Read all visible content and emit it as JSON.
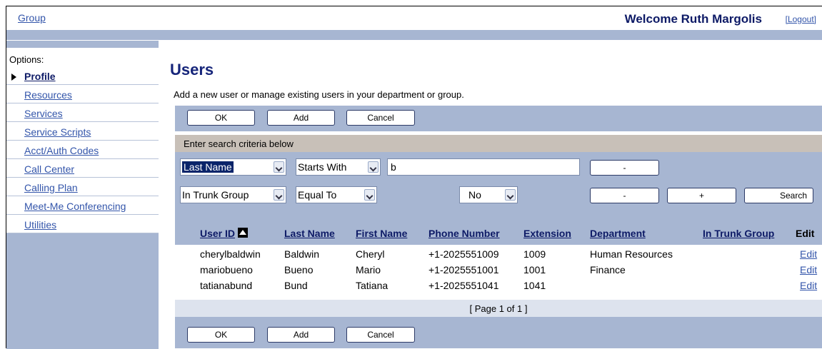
{
  "header": {
    "group_link": "Group",
    "welcome": "Welcome Ruth Margolis",
    "logout": "[Logout]"
  },
  "sidebar": {
    "title": "Options:",
    "items": [
      {
        "label": "Profile",
        "active": true
      },
      {
        "label": "Resources"
      },
      {
        "label": "Services"
      },
      {
        "label": "Service Scripts"
      },
      {
        "label": "Acct/Auth Codes"
      },
      {
        "label": "Call Center"
      },
      {
        "label": "Calling Plan"
      },
      {
        "label": "Meet-Me Conferencing"
      },
      {
        "label": "Utilities"
      }
    ]
  },
  "page": {
    "title": "Users",
    "description": "Add a new user or manage existing users in your department or group."
  },
  "buttons": {
    "ok": "OK",
    "add": "Add",
    "cancel": "Cancel"
  },
  "search": {
    "heading": "Enter search criteria below",
    "row1": {
      "field": "Last Name",
      "operator": "Starts With",
      "value": "b",
      "remove": "-"
    },
    "row2": {
      "field": "In Trunk Group",
      "operator": "Equal To",
      "value": "No",
      "remove": "-",
      "add": "+",
      "search": "Search"
    }
  },
  "table": {
    "headers": [
      "User ID",
      "Last Name",
      "First Name",
      "Phone Number",
      "Extension",
      "Department",
      "In Trunk Group",
      "Edit"
    ],
    "rows": [
      {
        "user_id": "cherylbaldwin",
        "last": "Baldwin",
        "first": "Cheryl",
        "phone": "+1-2025551009",
        "ext": "1009",
        "dept": "Human Resources",
        "trunk": "",
        "edit": "Edit"
      },
      {
        "user_id": "mariobueno",
        "last": "Bueno",
        "first": "Mario",
        "phone": "+1-2025551001",
        "ext": "1001",
        "dept": "Finance",
        "trunk": "",
        "edit": "Edit"
      },
      {
        "user_id": "tatianabund",
        "last": "Bund",
        "first": "Tatiana",
        "phone": "+1-2025551041",
        "ext": "1041",
        "dept": "",
        "trunk": "",
        "edit": "Edit"
      }
    ],
    "pager": "[ Page 1 of 1 ]"
  },
  "colors": {
    "band": "#a7b6d2",
    "link": "#3355aa",
    "heading": "#16257a",
    "search_head": "#c8c0b8"
  }
}
